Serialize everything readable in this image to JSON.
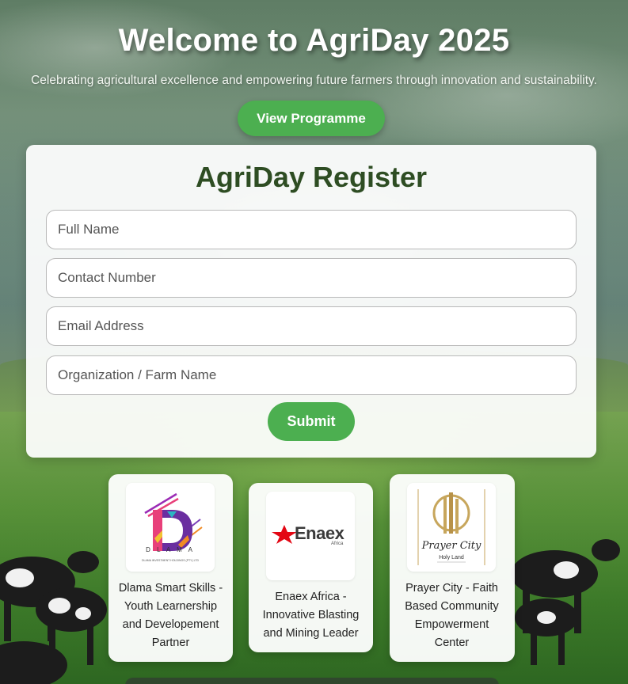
{
  "hero": {
    "title": "Welcome to AgriDay 2025",
    "subtitle": "Celebrating agricultural excellence and empowering future farmers through innovation and sustainability.",
    "programme_button": "View Programme"
  },
  "register": {
    "title": "AgriDay Register",
    "fields": [
      {
        "placeholder": "Full Name"
      },
      {
        "placeholder": "Contact Number"
      },
      {
        "placeholder": "Email Address"
      },
      {
        "placeholder": "Organization / Farm Name"
      }
    ],
    "submit_label": "Submit"
  },
  "partners": [
    {
      "logo_text": "D L A M A",
      "logo_small": "DLAMA INVESTMENT HOLDINGS (PTY) LTD",
      "description": "Dlama Smart Skills - Youth Learnership and Developement Partner"
    },
    {
      "logo_text": "Enaex",
      "logo_small": "Africa",
      "description": "Enaex Africa - Innovative Blasting and Mining Leader"
    },
    {
      "logo_text": "Prayer City",
      "logo_small": "Holy Land",
      "description": "Prayer City - Faith Based Community Empowerment Center"
    }
  ],
  "colors": {
    "primary_button": "#4caf50",
    "heading_green": "#2e4d23",
    "enaex_red": "#e30613"
  }
}
